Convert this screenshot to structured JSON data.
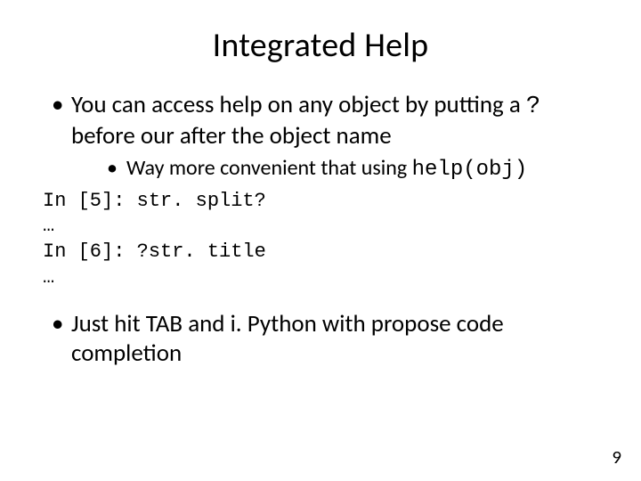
{
  "title": "Integrated Help",
  "bullets": {
    "b1_pre": "You can access help on any object by putting a ",
    "b1_code": "?",
    "b1_post": " before our after the object name",
    "b1_sub_pre": "Way more convenient that using ",
    "b1_sub_code": "help(obj)",
    "b2": "Just hit TAB and i. Python with propose code completion"
  },
  "code": "In [5]: str. split?\n…\nIn [6]: ?str. title\n…",
  "page_number": "9"
}
